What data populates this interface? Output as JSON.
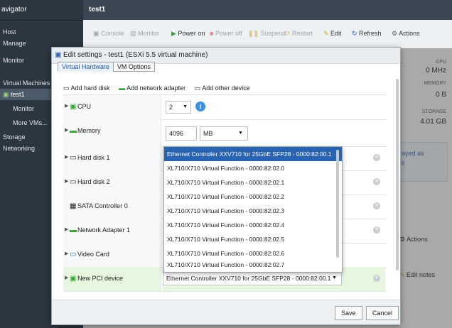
{
  "sidebar": {
    "title": "avigator",
    "items": [
      {
        "label": "Host"
      },
      {
        "label": "Manage"
      },
      {
        "label": "Monitor"
      },
      {
        "label": "Virtual Machines"
      },
      {
        "label": "test1"
      },
      {
        "label": "Monitor"
      },
      {
        "label": "More VMs..."
      },
      {
        "label": "Storage"
      },
      {
        "label": "Networking"
      }
    ]
  },
  "topbar": {
    "title": "test1"
  },
  "toolbar": {
    "console": "Console",
    "monitor": "Monitor",
    "power_on": "Power on",
    "power_off": "Power off",
    "suspend": "Suspend",
    "restart": "Restart",
    "edit": "Edit",
    "refresh": "Refresh",
    "actions": "Actions"
  },
  "right_panel": {
    "cpu_label": "CPU",
    "cpu_value": "0 MHz",
    "memory_label": "MEMORY",
    "memory_value": "0 B",
    "storage_label": "STORAGE",
    "storage_value": "4.01 GB",
    "notice": "ayed as",
    "notice2": "ll",
    "actions": "Actions",
    "edit_notes": "Edit notes"
  },
  "dialog": {
    "title": "Edit settings - test1 (ESXi 5.5 virtual machine)",
    "tabs": [
      "Virtual Hardware",
      "VM Options"
    ],
    "add_hard_disk": "Add hard disk",
    "add_network_adapter": "Add network adapter",
    "add_other_device": "Add other device",
    "rows": [
      {
        "label": "CPU"
      },
      {
        "label": "Memory"
      },
      {
        "label": "Hard disk 1"
      },
      {
        "label": "Hard disk 2"
      },
      {
        "label": "SATA Controller 0"
      },
      {
        "label": "Network Adapter 1"
      },
      {
        "label": "Video Card"
      },
      {
        "label": "New PCI device"
      }
    ],
    "cpu_value": "2",
    "memory_value": "4096",
    "memory_unit": "MB",
    "pci_selected": "Ethernet Controller XXV710 for 25GbE SFP28 - 0000:82:00.1",
    "dropdown_items": [
      "Ethernet Controller XXV710 for 25GbE SFP28 - 0000:82:00.1",
      "XL710/X710 Virtual Function - 0000:82:02.0",
      "XL710/X710 Virtual Function - 0000:82:02.1",
      "XL710/X710 Virtual Function - 0000:82:02.2",
      "XL710/X710 Virtual Function - 0000:82:02.3",
      "XL710/X710 Virtual Function - 0000:82:02.4",
      "XL710/X710 Virtual Function - 0000:82:02.5",
      "XL710/X710 Virtual Function - 0000:82:02.6",
      "XL710/X710 Virtual Function - 0000:82:02.7"
    ],
    "save": "Save",
    "cancel": "Cancel"
  },
  "colors": {
    "sidebar_bg": "#2c3640",
    "selection": "#2a63b2",
    "pci_row": "#e6f6df",
    "accent_green": "#3aa43a"
  }
}
